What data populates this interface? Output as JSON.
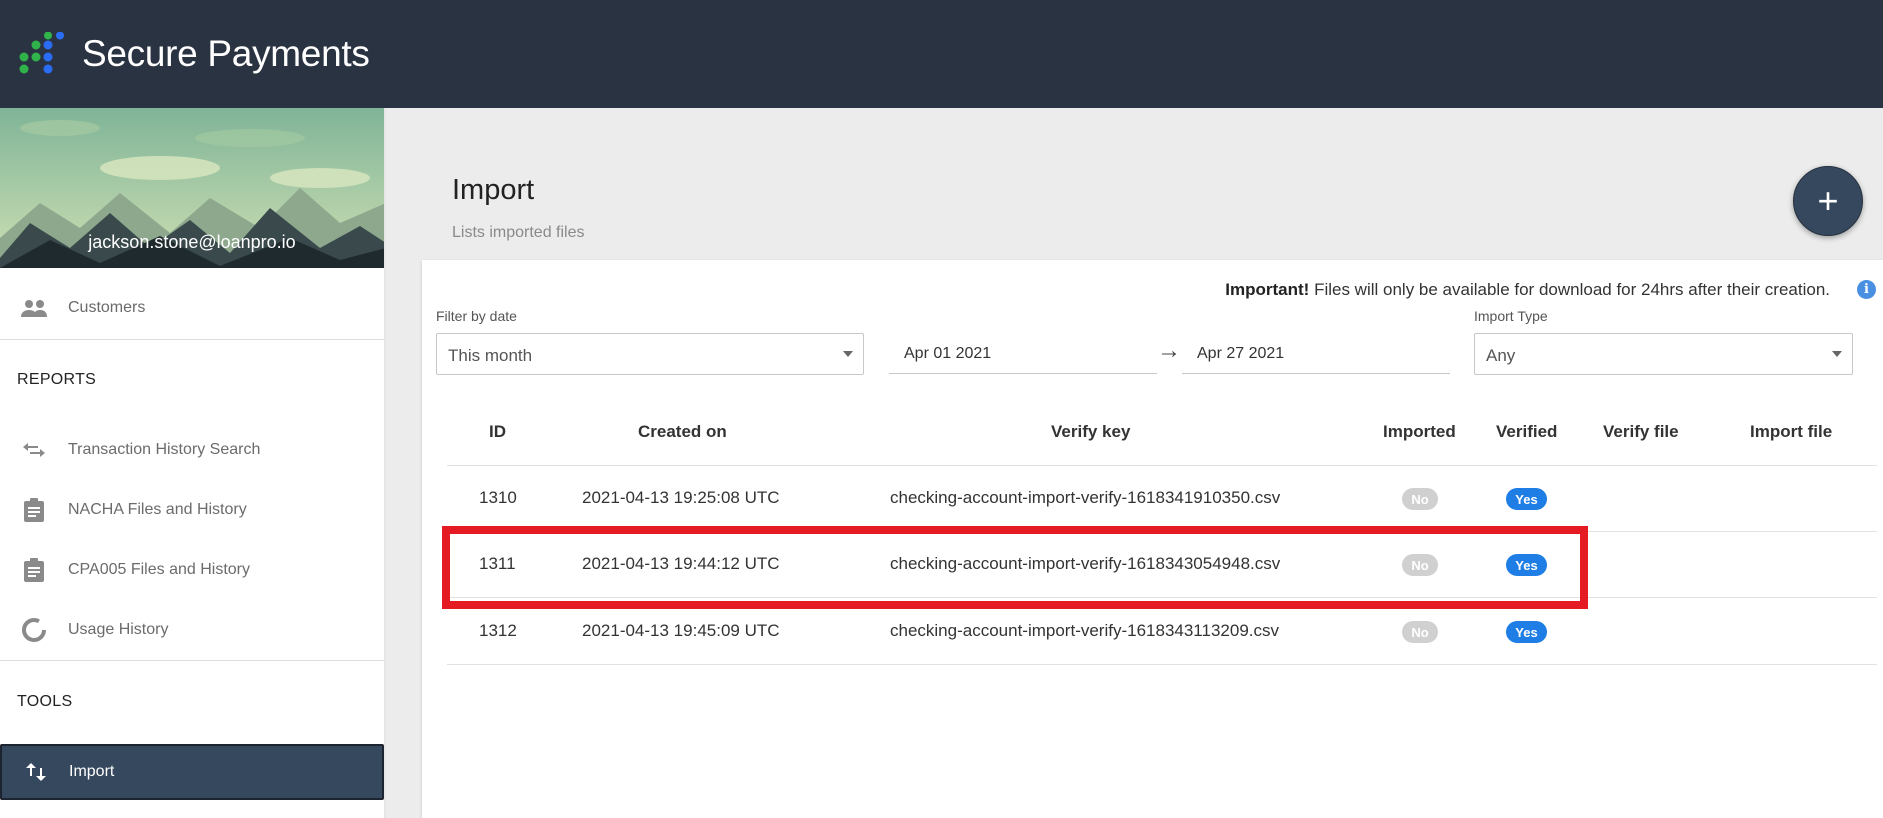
{
  "header": {
    "brand": "Secure Payments"
  },
  "sidebar": {
    "user_email": "jackson.stone@loanpro.io",
    "items": [
      {
        "label": "Customers",
        "icon": "people-icon"
      },
      {
        "label": "Transaction History Search",
        "icon": "swap-arrows-icon"
      },
      {
        "label": "NACHA Files and History",
        "icon": "clipboard-icon"
      },
      {
        "label": "CPA005 Files and History",
        "icon": "clipboard-icon"
      },
      {
        "label": "Usage History",
        "icon": "donut-chart-icon"
      },
      {
        "label": "Import",
        "icon": "import-arrows-icon",
        "active": true
      }
    ],
    "sections": {
      "reports": "REPORTS",
      "tools": "TOOLS"
    }
  },
  "page": {
    "title": "Import",
    "subtitle": "Lists imported files",
    "add_button": "+"
  },
  "notice": {
    "strong": "Important!",
    "text": " Files will only be available for download for 24hrs after their creation."
  },
  "filters": {
    "date_label": "Filter by date",
    "date_value": "This month",
    "start_date": "Apr 01 2021",
    "end_date": "Apr 27 2021",
    "arrow": "→",
    "type_label": "Import Type",
    "type_value": "Any"
  },
  "table": {
    "columns": [
      "ID",
      "Created on",
      "Verify key",
      "Imported",
      "Verified",
      "Verify file",
      "Import file"
    ],
    "rows": [
      {
        "id": "1310",
        "created": "2021-04-13 19:25:08 UTC",
        "key": "checking-account-import-verify-1618341910350.csv",
        "imported": "No",
        "verified": "Yes"
      },
      {
        "id": "1311",
        "created": "2021-04-13 19:44:12 UTC",
        "key": "checking-account-import-verify-1618343054948.csv",
        "imported": "No",
        "verified": "Yes"
      },
      {
        "id": "1312",
        "created": "2021-04-13 19:45:09 UTC",
        "key": "checking-account-import-verify-1618343113209.csv",
        "imported": "No",
        "verified": "Yes"
      }
    ]
  },
  "colors": {
    "header_bg": "#2a3342",
    "accent": "#36485e",
    "yes_badge": "#1e7ee6",
    "no_badge": "#d0d0d0",
    "highlight": "#e41b23"
  }
}
